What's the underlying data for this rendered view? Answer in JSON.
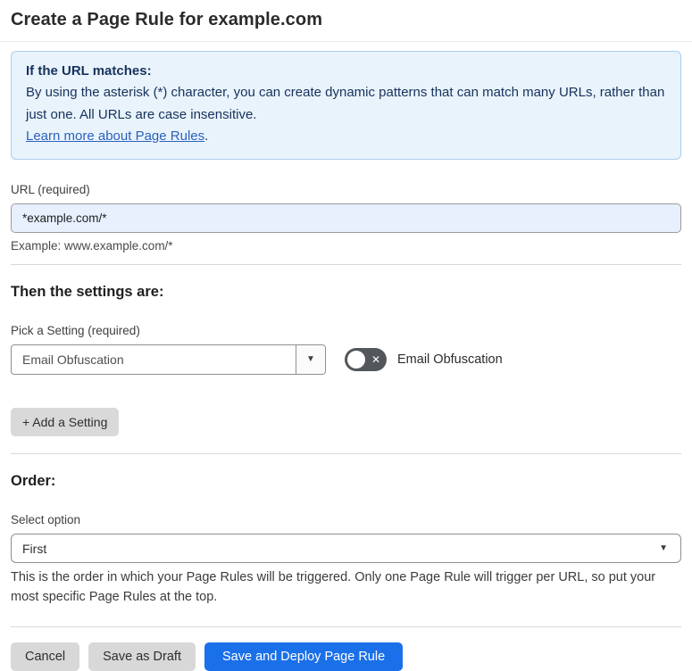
{
  "page": {
    "title": "Create a Page Rule for example.com"
  },
  "info_box": {
    "heading": "If the URL matches:",
    "body": "By using the asterisk (*) character, you can create dynamic patterns that can match many URLs, rather than just one. All URLs are case insensitive.",
    "link_label": "Learn more about Page Rules",
    "link_suffix": "."
  },
  "url_field": {
    "label": "URL (required)",
    "value": "*example.com/*",
    "helper": "Example: www.example.com/*"
  },
  "settings_section": {
    "heading": "Then the settings are:",
    "picker_label": "Pick a Setting (required)",
    "selected_setting": "Email Obfuscation",
    "toggle_label": "Email Obfuscation",
    "toggle_state": "off",
    "add_setting_label": "+ Add a Setting"
  },
  "order_section": {
    "heading": "Order:",
    "select_label": "Select option",
    "selected_option": "First",
    "helper": "This is the order in which your Page Rules will be triggered. Only one Page Rule will trigger per URL, so put your most specific Page Rules at the top."
  },
  "footer": {
    "cancel_label": "Cancel",
    "save_draft_label": "Save as Draft",
    "save_deploy_label": "Save and Deploy Page Rule"
  },
  "icons": {
    "select_arrow": "▼",
    "toggle_x": "✕"
  },
  "colors": {
    "accent_blue": "#1a70e8",
    "info_bg": "#e9f3fc",
    "info_border": "#abcdec",
    "info_text": "#16325c",
    "link_blue": "#2b62ba",
    "input_autofill_bg": "#e8f0fe",
    "toggle_off_bg": "#53565a",
    "button_gray": "#d8d8d8"
  }
}
